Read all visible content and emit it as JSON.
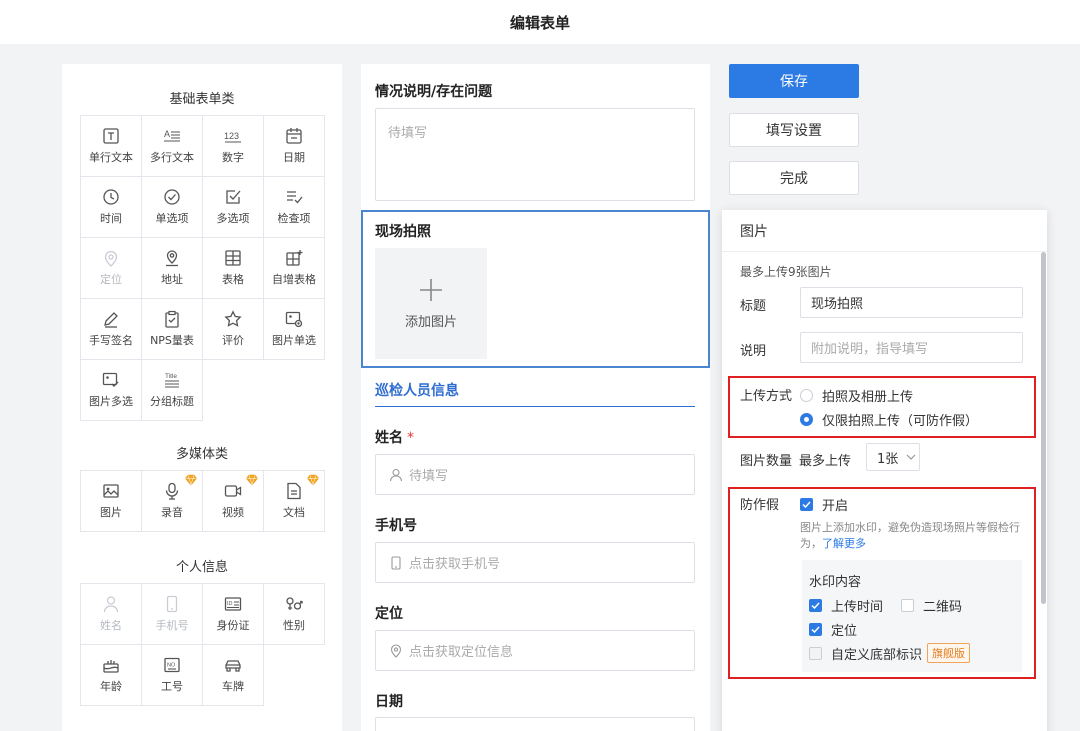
{
  "header": {
    "title": "编辑表单"
  },
  "palette": {
    "basic_title": "基础表单类",
    "basic_items": [
      {
        "label": "单行文本",
        "icon": "text-box-icon",
        "disabled": false
      },
      {
        "label": "多行文本",
        "icon": "multiline-text-icon",
        "disabled": false
      },
      {
        "label": "数字",
        "icon": "number-icon",
        "disabled": false
      },
      {
        "label": "日期",
        "icon": "calendar-icon",
        "disabled": false
      },
      {
        "label": "时间",
        "icon": "clock-icon",
        "disabled": false
      },
      {
        "label": "单选项",
        "icon": "radio-check-icon",
        "disabled": false
      },
      {
        "label": "多选项",
        "icon": "checkbox-icon",
        "disabled": false
      },
      {
        "label": "检查项",
        "icon": "checklist-icon",
        "disabled": false
      },
      {
        "label": "定位",
        "icon": "location-pin-icon",
        "disabled": true
      },
      {
        "label": "地址",
        "icon": "address-pin-icon",
        "disabled": false
      },
      {
        "label": "表格",
        "icon": "table-icon",
        "disabled": false
      },
      {
        "label": "自增表格",
        "icon": "table-plus-icon",
        "disabled": false
      },
      {
        "label": "手写签名",
        "icon": "pen-icon",
        "disabled": false
      },
      {
        "label": "NPS量表",
        "icon": "clipboard-icon",
        "disabled": false
      },
      {
        "label": "评价",
        "icon": "star-icon",
        "disabled": false
      },
      {
        "label": "图片单选",
        "icon": "image-radio-icon",
        "disabled": false
      },
      {
        "label": "图片多选",
        "icon": "image-check-icon",
        "disabled": false
      },
      {
        "label": "分组标题",
        "icon": "title-icon",
        "disabled": false
      }
    ],
    "media_title": "多媒体类",
    "media_items": [
      {
        "label": "图片",
        "icon": "image-icon",
        "vip": false
      },
      {
        "label": "录音",
        "icon": "microphone-icon",
        "vip": true
      },
      {
        "label": "视频",
        "icon": "video-icon",
        "vip": true
      },
      {
        "label": "文档",
        "icon": "document-icon",
        "vip": true
      }
    ],
    "personal_title": "个人信息",
    "personal_items": [
      {
        "label": "姓名",
        "icon": "person-icon",
        "disabled": true
      },
      {
        "label": "手机号",
        "icon": "phone-icon",
        "disabled": true
      },
      {
        "label": "身份证",
        "icon": "id-card-icon",
        "disabled": false
      },
      {
        "label": "性别",
        "icon": "gender-icon",
        "disabled": false
      },
      {
        "label": "年龄",
        "icon": "cake-icon",
        "disabled": false
      },
      {
        "label": "工号",
        "icon": "badge-icon",
        "disabled": false
      },
      {
        "label": "车牌",
        "icon": "car-icon",
        "disabled": false
      }
    ]
  },
  "form": {
    "desc_title": "情况说明/存在问题",
    "desc_placeholder": "待填写",
    "photo_title": "现场拍照",
    "photo_add_label": "添加图片",
    "section_header": "巡检人员信息",
    "name_title": "姓名",
    "required_mark": "*",
    "name_placeholder": "待填写",
    "phone_title": "手机号",
    "phone_placeholder": "点击获取手机号",
    "location_title": "定位",
    "location_placeholder": "点击获取定位信息",
    "date_title": "日期"
  },
  "actions": {
    "save": "保存",
    "settings": "填写设置",
    "done": "完成"
  },
  "panel": {
    "heading": "图片",
    "max_hint": "最多上传9张图片",
    "title_label": "标题",
    "title_value": "现场拍照",
    "desc_label": "说明",
    "desc_placeholder": "附加说明，指导填写",
    "upload_mode_label": "上传方式",
    "upload_option_1": "拍照及相册上传",
    "upload_option_2": "仅限拍照上传（可防作假）",
    "upload_selected": 2,
    "count_label": "图片数量",
    "count_prefix": "最多上传",
    "count_value": "1张",
    "anti_fake_label": "防作假",
    "anti_fake_on": "开启",
    "anti_fake_desc": "图片上添加水印，避免伪造现场照片等假检行为，",
    "learn_more": "了解更多",
    "watermark_title": "水印内容",
    "wm_time": "上传时间",
    "wm_qrcode": "二维码",
    "wm_location": "定位",
    "wm_custom": "自定义底部标识",
    "flagship_tag": "旗舰版"
  },
  "colors": {
    "primary": "#2c7be5",
    "highlight_border": "#e02020",
    "section_blue": "#2f6dd0",
    "flagship_tag": "#e67e22"
  }
}
